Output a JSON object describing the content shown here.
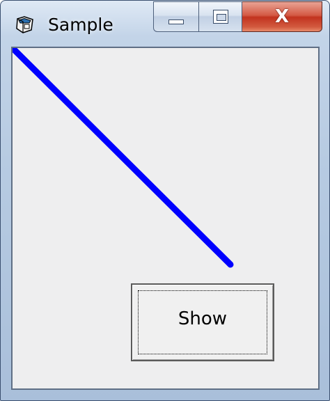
{
  "window": {
    "title": "Sample",
    "icon": "app-window-icon",
    "caption_buttons": {
      "minimize_icon": "minimize-icon",
      "maximize_icon": "maximize-icon",
      "close_glyph": "X"
    }
  },
  "form": {
    "background_color": "#eeeeef",
    "line": {
      "color": "#0000ff"
    },
    "show_button": {
      "label": "Show"
    }
  }
}
